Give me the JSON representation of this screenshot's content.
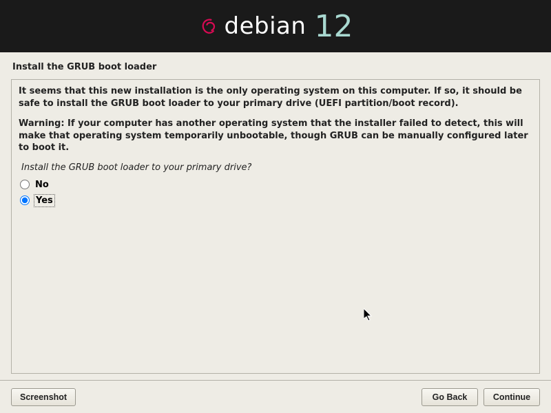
{
  "header": {
    "brand": "debian",
    "version": "12"
  },
  "page_title": "Install the GRUB boot loader",
  "info_para1": "It seems that this new installation is the only operating system on this computer. If so, it should be safe to install the GRUB boot loader to your primary drive (UEFI partition/boot record).",
  "info_para2": "Warning: If your computer has another operating system that the installer failed to detect, this will make that operating system temporarily unbootable, though GRUB can be manually configured later to boot it.",
  "question": "Install the GRUB boot loader to your primary drive?",
  "options": {
    "no": "No",
    "yes": "Yes"
  },
  "selected_option": "yes",
  "buttons": {
    "screenshot": "Screenshot",
    "go_back": "Go Back",
    "continue": "Continue"
  }
}
